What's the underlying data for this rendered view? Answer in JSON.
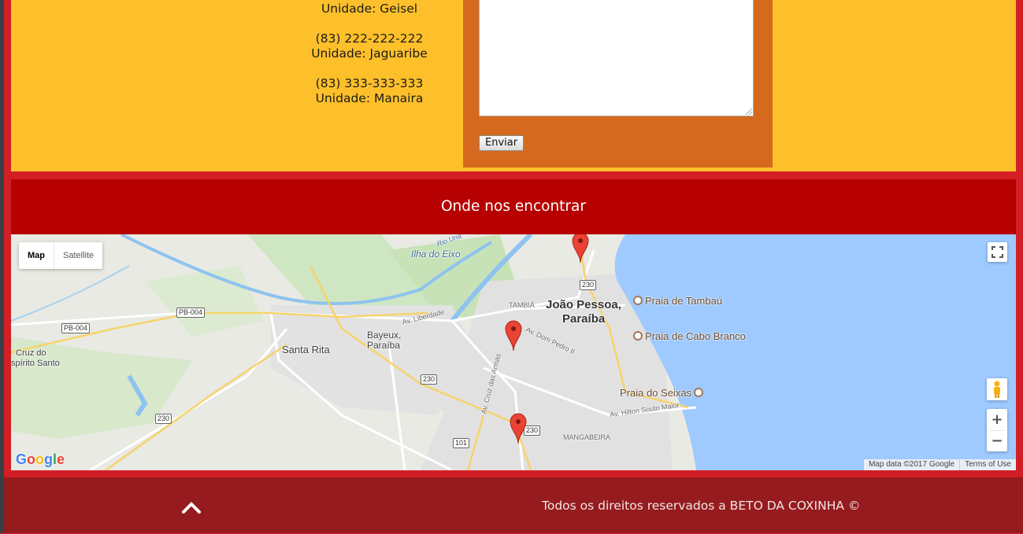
{
  "contacts": [
    {
      "phone": "",
      "unit": "Unidade: Geisel"
    },
    {
      "phone": "(83) 222-222-222",
      "unit": "Unidade: Jaguaribe"
    },
    {
      "phone": "(83) 333-333-333",
      "unit": "Unidade: Manaira"
    }
  ],
  "form": {
    "send_label": "Enviar"
  },
  "find_us": {
    "title": "Onde nos encontrar"
  },
  "map": {
    "type_controls": {
      "map": "Map",
      "satellite": "Satellite"
    },
    "attribution": {
      "data": "Map data ©2017 Google",
      "terms": "Terms of Use"
    },
    "logo": "Google",
    "places": {
      "ilha": "Ilha do Eixo",
      "tambia": "TAMBIÁ",
      "jp1": "João Pessoa,",
      "jp2": "Paraíba",
      "bayeux1": "Bayeux,",
      "bayeux2": "Paraíba",
      "santa_rita": "Santa Rita",
      "cruz1": "Cruz do",
      "cruz2": "spírito Santo",
      "mangabeira": "MANGABEIRA",
      "av_liberdade": "Av. Liberdade",
      "av_dom_pedro": "Av. Dom Pedro II",
      "av_cruz": "Av. Cruz das Armas",
      "av_hilton": "Av. Hilton Souto Maior",
      "rio": "Rio Una"
    },
    "pois": {
      "tambau": "Praia de Tambaú",
      "cabo_branco": "Praia de Cabo Branco",
      "seixas": "Praia do Seixas"
    },
    "shields": {
      "pb004_a": "PB-004",
      "pb004_b": "PB-004",
      "r230_a": "230",
      "r230_b": "230",
      "r230_c": "230",
      "r230_d": "230",
      "r101": "101"
    },
    "colors": {
      "water": "#9fcaff",
      "marker": "#ea4335"
    }
  },
  "footer": {
    "copyright": "Todos os direitos reservados a BETO DA COXINHA ©"
  }
}
